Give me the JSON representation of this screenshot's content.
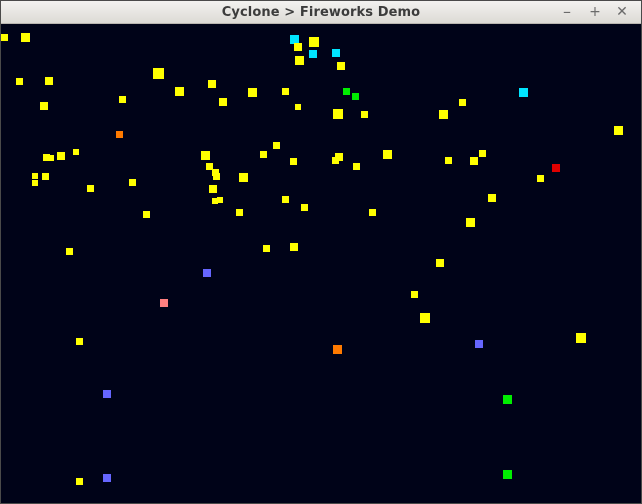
{
  "window": {
    "title": "Cyclone > Fireworks Demo",
    "minimize_glyph": "–",
    "maximize_glyph": "+",
    "close_glyph": "✕"
  },
  "palette": {
    "background": "#000318",
    "yellow": "#ffff00",
    "cyan": "#00e5ff",
    "green": "#00ee00",
    "orange": "#ff7a00",
    "red": "#e00000",
    "blue": "#6666ff",
    "pink": "#ff8080"
  },
  "particle_count": 106
}
